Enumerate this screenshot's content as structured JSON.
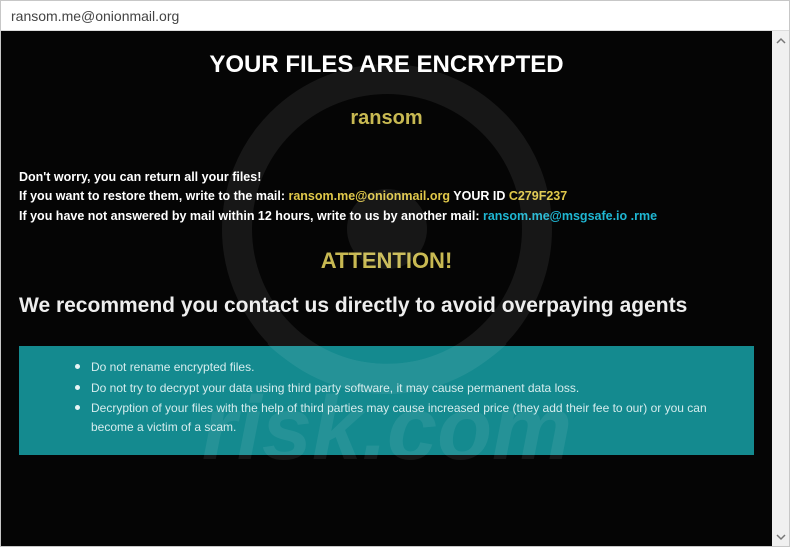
{
  "window": {
    "title": "ransom.me@onionmail.org"
  },
  "heading": "YOUR FILES ARE ENCRYPTED",
  "subheading": "ransom",
  "info": {
    "line1": "Don't worry, you can return all your files!",
    "line2_pre": "If you want to restore them, write to the mail:   ",
    "email1": "ransom.me@onionmail.org",
    "id_label": "   YOUR ID ",
    "id_value": "C279F237",
    "line3_pre": "If you have not answered by mail within 12 hours, write to us by another mail:   ",
    "email2": "ransom.me@msgsafe.io .rme"
  },
  "attention": "ATTENTION!",
  "recommend": "We recommend you contact us directly to avoid overpaying agents",
  "bullets": {
    "items": [
      "Do not rename encrypted files.",
      "Do not try to decrypt your data using third party software, it may cause permanent data loss.",
      "Decryption of your files with the help of third parties may cause increased price (they add their fee to our) or you can become a victim of a scam."
    ]
  },
  "watermark_text": "pcrisk.com"
}
